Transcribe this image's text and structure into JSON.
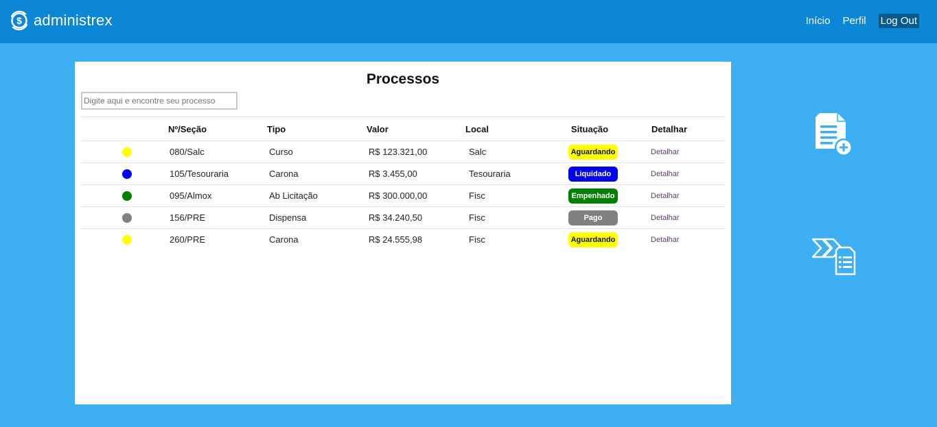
{
  "brand": {
    "name": "administrex"
  },
  "nav": [
    {
      "label": "Início"
    },
    {
      "label": "Perfil"
    },
    {
      "label": "Log Out"
    }
  ],
  "page": {
    "title": "Processos",
    "search_placeholder": "Digite aqui e encontre seu processo"
  },
  "table": {
    "headers": {
      "num": "Nº/Seção",
      "tipo": "Tipo",
      "valor": "Valor",
      "local": "Local",
      "situacao": "Situação",
      "detalhar": "Detalhar"
    },
    "rows": [
      {
        "num": "080/Salc",
        "tipo": "Curso",
        "valor": "R$ 123.321,00",
        "local": "Salc",
        "situacao": "Aguardando",
        "detalhar": "Detalhar",
        "color": "#ffff00",
        "badge_bg": "#ffff00",
        "badge_fg": "#111111"
      },
      {
        "num": "105/Tesouraria",
        "tipo": "Carona",
        "valor": "R$ 3.455,00",
        "local": "Tesouraria",
        "situacao": "Liquidado",
        "detalhar": "Detalhar",
        "color": "#0000ee",
        "badge_bg": "#0000ee",
        "badge_fg": "#ffffff"
      },
      {
        "num": "095/Almox",
        "tipo": "Ab Licitação",
        "valor": "R$ 300.000,00",
        "local": "Fisc",
        "situacao": "Empenhado",
        "detalhar": "Detalhar",
        "color": "#008000",
        "badge_bg": "#008000",
        "badge_fg": "#ffffff"
      },
      {
        "num": "156/PRE",
        "tipo": "Dispensa",
        "valor": "R$ 34.240,50",
        "local": "Fisc",
        "situacao": "Pago",
        "detalhar": "Detalhar",
        "color": "#808080",
        "badge_bg": "#808080",
        "badge_fg": "#ffffff"
      },
      {
        "num": "260/PRE",
        "tipo": "Carona",
        "valor": "R$ 24.555,98",
        "local": "Fisc",
        "situacao": "Aguardando",
        "detalhar": "Detalhar",
        "color": "#ffff00",
        "badge_bg": "#ffff00",
        "badge_fg": "#111111"
      }
    ]
  },
  "side_actions": [
    {
      "icon": "add-document-icon"
    },
    {
      "icon": "forward-list-icon"
    }
  ],
  "colors": {
    "navbar": "#0b87d6",
    "background": "#3daff3",
    "logout_bg": "#075a8c"
  }
}
